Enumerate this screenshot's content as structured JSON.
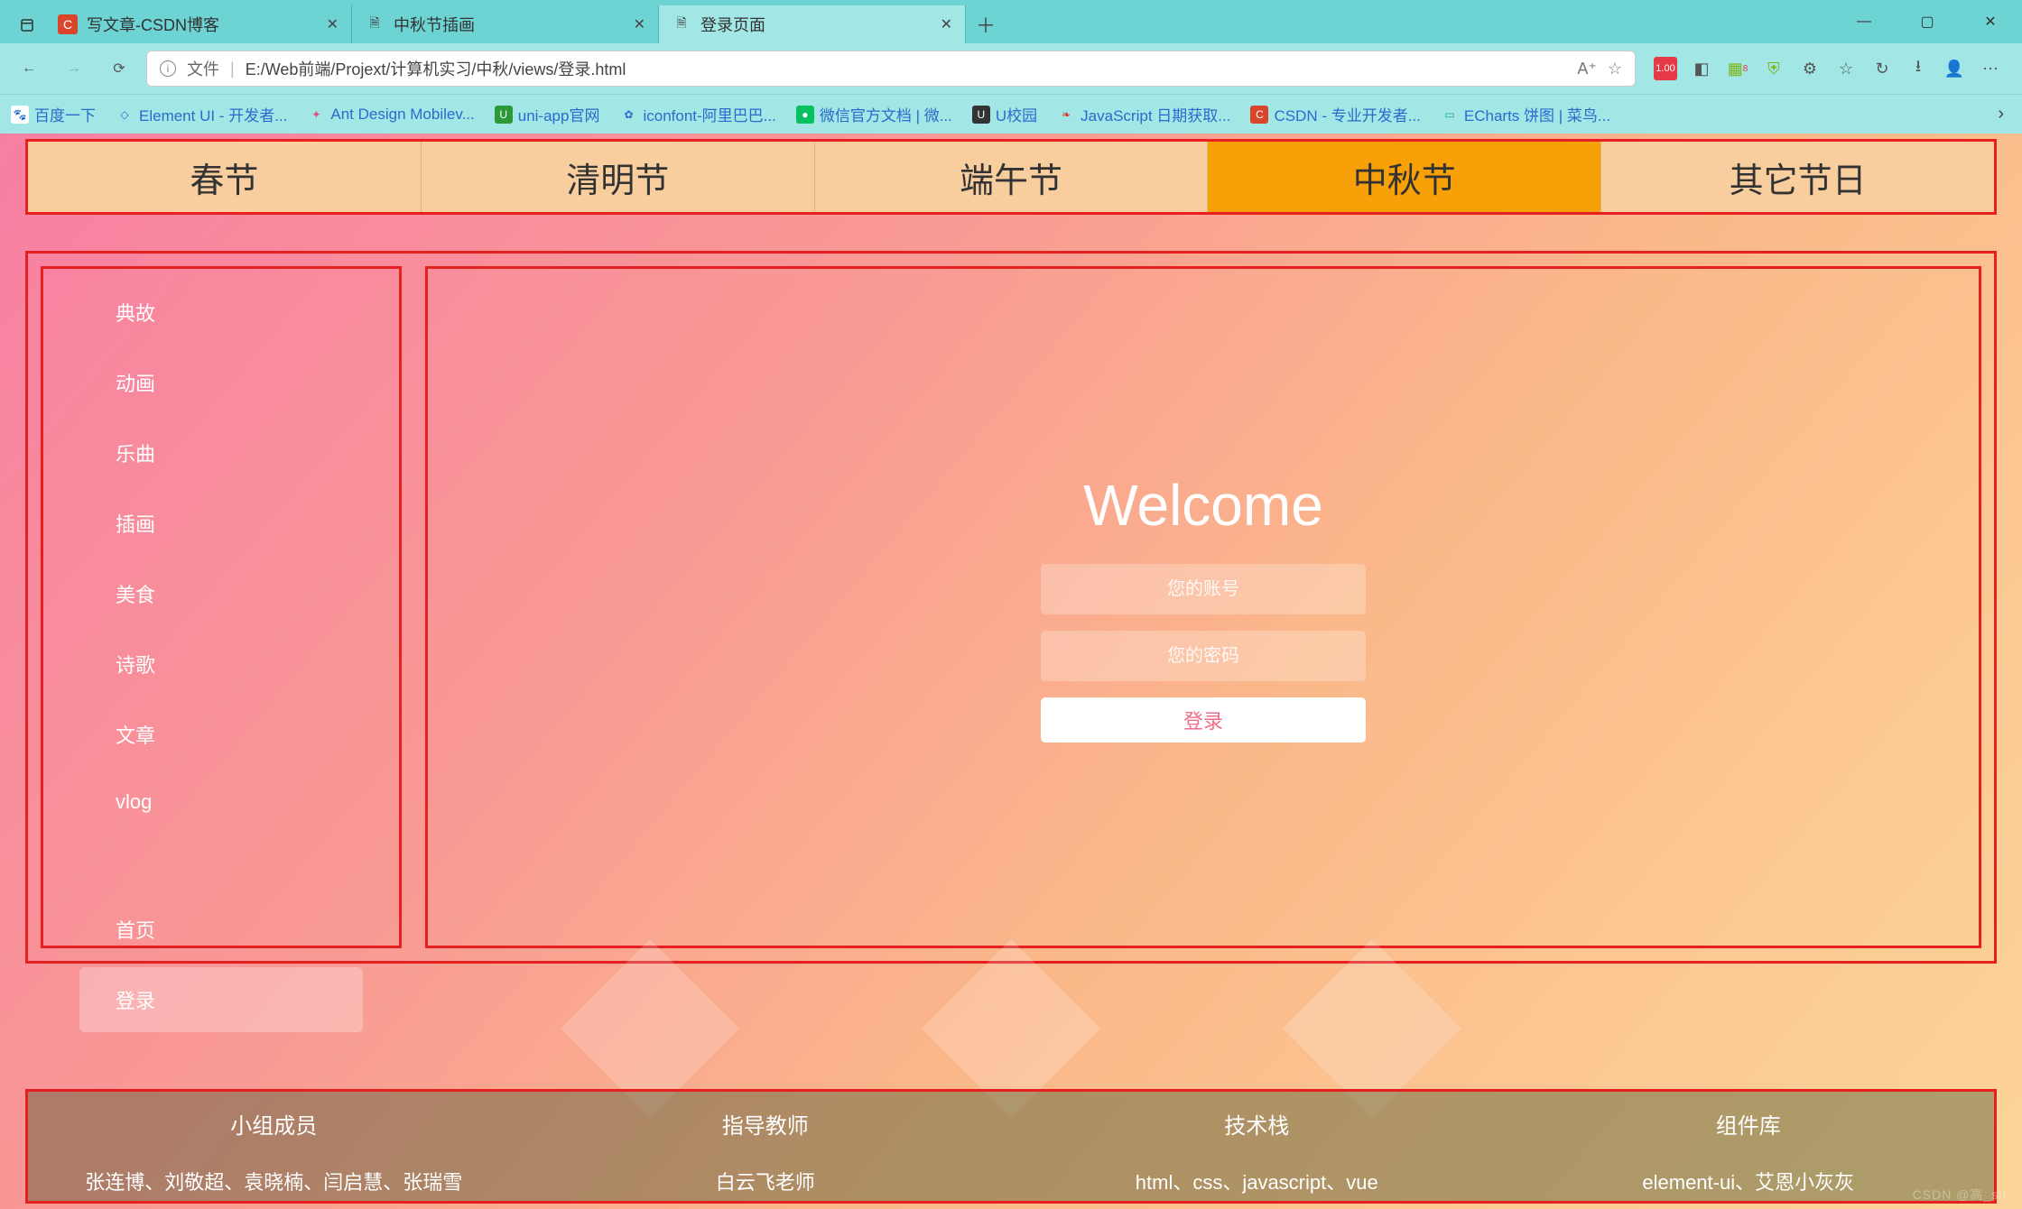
{
  "browser": {
    "tabs": [
      {
        "label": "写文章-CSDN博客",
        "favicon_bg": "#d9462b",
        "favicon_fg": "#fff",
        "favicon_text": "C"
      },
      {
        "label": "中秋节插画",
        "favicon_bg": "#fff",
        "favicon_fg": "#666",
        "favicon_text": "🗎"
      },
      {
        "label": "登录页面",
        "favicon_bg": "#fff",
        "favicon_fg": "#666",
        "favicon_text": "🗎"
      }
    ],
    "active_tab": 2,
    "url_label": "文件",
    "url": "E:/Web前端/Projext/计算机实习/中秋/views/登录.html",
    "bookmarks": [
      {
        "label": "百度一下",
        "icon_bg": "#fff",
        "icon_fg": "#2a6bcc",
        "icon_text": "🐾"
      },
      {
        "label": "Element UI - 开发者...",
        "icon_bg": "#fff",
        "icon_fg": "#409eff",
        "icon_text": "◇"
      },
      {
        "label": "Ant Design Mobilev...",
        "icon_bg": "#fff",
        "icon_fg": "#e64980",
        "icon_text": "✦"
      },
      {
        "label": "uni-app官网",
        "icon_bg": "#2b9939",
        "icon_fg": "#fff",
        "icon_text": "U"
      },
      {
        "label": "iconfont-阿里巴巴...",
        "icon_bg": "#fff",
        "icon_fg": "#666",
        "icon_text": "✿"
      },
      {
        "label": "微信官方文档 | 微...",
        "icon_bg": "#07c160",
        "icon_fg": "#fff",
        "icon_text": "●"
      },
      {
        "label": "U校园",
        "icon_bg": "#333",
        "icon_fg": "#fff",
        "icon_text": "U"
      },
      {
        "label": "JavaScript 日期获取...",
        "icon_bg": "#fff",
        "icon_fg": "#d33",
        "icon_text": "❧"
      },
      {
        "label": "CSDN - 专业开发者...",
        "icon_bg": "#d9462b",
        "icon_fg": "#fff",
        "icon_text": "C"
      },
      {
        "label": "ECharts 饼图 | 菜鸟...",
        "icon_bg": "#fff",
        "icon_fg": "#1a9",
        "icon_text": "▭"
      }
    ]
  },
  "top_nav": {
    "items": [
      "春节",
      "清明节",
      "端午节",
      "中秋节",
      "其它节日"
    ],
    "active": 3
  },
  "sidebar": {
    "group1": [
      "典故",
      "动画",
      "乐曲",
      "插画",
      "美食",
      "诗歌",
      "文章",
      "vlog"
    ],
    "group2": [
      "首页",
      "登录"
    ],
    "active": "登录"
  },
  "login": {
    "title": "Welcome",
    "account_placeholder": "您的账号",
    "password_placeholder": "您的密码",
    "button": "登录"
  },
  "footer": {
    "headers": [
      "小组成员",
      "指导教师",
      "技术栈",
      "组件库"
    ],
    "values": [
      "张连博、刘敬超、袁晓楠、闫启慧、张瑞雪",
      "白云飞老师",
      "html、css、javascript、vue",
      "element-ui、艾恩小灰灰"
    ]
  },
  "watermark": "CSDN @高_sir"
}
